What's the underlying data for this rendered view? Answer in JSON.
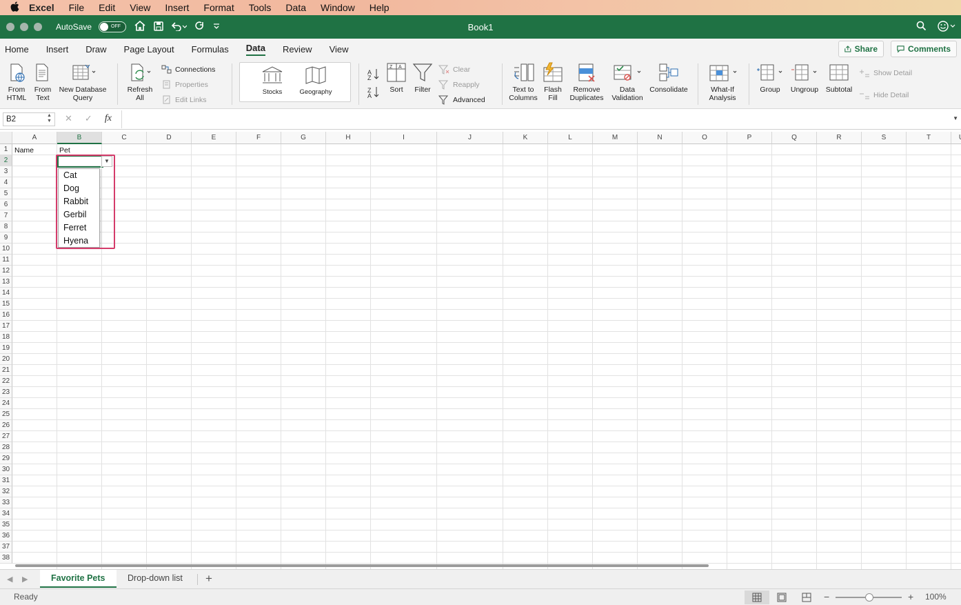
{
  "menubar": {
    "apple": "",
    "app": "Excel",
    "items": [
      "File",
      "Edit",
      "View",
      "Insert",
      "Format",
      "Tools",
      "Data",
      "Window",
      "Help"
    ]
  },
  "titlebar": {
    "autosave_label": "AutoSave",
    "autosave_state": "OFF",
    "document_title": "Book1"
  },
  "ribbon_tabs": {
    "items": [
      "Home",
      "Insert",
      "Draw",
      "Page Layout",
      "Formulas",
      "Data",
      "Review",
      "View"
    ],
    "active": "Data",
    "share_label": "Share",
    "comments_label": "Comments"
  },
  "ribbon": {
    "from_html": [
      "From",
      "HTML"
    ],
    "from_text": [
      "From",
      "Text"
    ],
    "new_db_query": [
      "New Database",
      "Query"
    ],
    "refresh_all": [
      "Refresh",
      "All"
    ],
    "connections": "Connections",
    "properties": "Properties",
    "edit_links": "Edit Links",
    "stocks": "Stocks",
    "geography": "Geography",
    "sort": "Sort",
    "filter": "Filter",
    "clear": "Clear",
    "reapply": "Reapply",
    "advanced": "Advanced",
    "text_to_columns": [
      "Text to",
      "Columns"
    ],
    "flash_fill": [
      "Flash",
      "Fill"
    ],
    "remove_duplicates": [
      "Remove",
      "Duplicates"
    ],
    "data_validation": [
      "Data",
      "Validation"
    ],
    "consolidate": "Consolidate",
    "what_if": [
      "What-If",
      "Analysis"
    ],
    "group": "Group",
    "ungroup": "Ungroup",
    "subtotal": "Subtotal",
    "show_detail": "Show Detail",
    "hide_detail": "Hide Detail"
  },
  "formula_bar": {
    "name_box": "B2",
    "fx": "fx",
    "value": ""
  },
  "sheet": {
    "columns": [
      "A",
      "B",
      "C",
      "D",
      "E",
      "F",
      "G",
      "H",
      "I",
      "J",
      "K",
      "L",
      "M",
      "N",
      "O",
      "P",
      "Q",
      "R",
      "S",
      "T",
      "U"
    ],
    "row_count": 38,
    "selected_column": "B",
    "selected_row": 2,
    "cells": {
      "A1": "Name",
      "B1": "Pet"
    },
    "dropdown_options": [
      "Cat",
      "Dog",
      "Rabbit",
      "Gerbil",
      "Ferret",
      "Hyena"
    ]
  },
  "sheet_tabs": {
    "tabs": [
      "Favorite Pets",
      "Drop-down list"
    ],
    "active": "Favorite Pets",
    "add": "+"
  },
  "status": {
    "left": "Ready",
    "zoom": "100%",
    "zoom_minus": "−",
    "zoom_plus": "+"
  },
  "colors": {
    "excel_green": "#1f7244",
    "highlight": "#d43b6a"
  }
}
